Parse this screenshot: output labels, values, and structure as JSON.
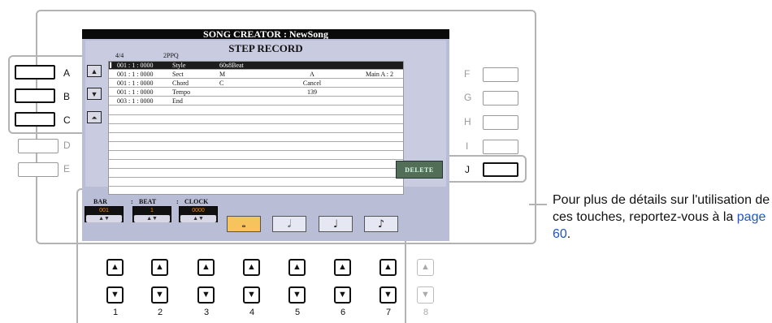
{
  "screen": {
    "title": "SONG CREATOR : NewSong",
    "panel_title": "STEP RECORD",
    "time_signature": "4/4",
    "resolution": "2PPQ",
    "events": [
      {
        "time": "001 : 1 : 0000",
        "event": "Style",
        "col1": "60s8Beat",
        "col2": "",
        "col3": "",
        "selected": true
      },
      {
        "time": "001 : 1 : 0000",
        "event": "Sect",
        "col1": "M",
        "col2": "A",
        "col3": "Main A    : 2",
        "selected": false
      },
      {
        "time": "001 : 1 : 0000",
        "event": "Chord",
        "col1": "C",
        "col2": "Cancel",
        "col3": "",
        "selected": false
      },
      {
        "time": "001 : 1 : 0000",
        "event": "Tempo",
        "col1": "",
        "col2": "139",
        "col3": "",
        "selected": false
      },
      {
        "time": "003 : 1 : 0000",
        "event": "End",
        "col1": "",
        "col2": "",
        "col3": "",
        "selected": false
      }
    ],
    "delete_label": "DELETE",
    "fields": {
      "bar_label": "BAR",
      "bar_value": "001",
      "beat_label": "BEAT",
      "beat_value": "1",
      "clock_label": "CLOCK",
      "clock_value": "0000",
      "sep1": ":",
      "sep2": ":"
    },
    "notes": [
      "whole-note",
      "half-note",
      "quarter-note",
      "eighth-note"
    ],
    "note_glyphs": [
      "𝅝",
      "𝅗𝅥",
      "♩",
      "♪"
    ]
  },
  "left_buttons": [
    "A",
    "B",
    "C",
    "D",
    "E"
  ],
  "right_buttons": [
    "F",
    "G",
    "H",
    "I",
    "J"
  ],
  "bottom_numbers": [
    "1",
    "2",
    "3",
    "4",
    "5",
    "6",
    "7",
    "8"
  ],
  "callout": {
    "text_before": "Pour plus de détails sur l'utilisation de ces touches, reportez-vous à la ",
    "link_text": "page 60",
    "text_after": "."
  },
  "colors": {
    "highlight": "#f6c35c",
    "delete": "#536e57",
    "link": "#1f55c8"
  }
}
